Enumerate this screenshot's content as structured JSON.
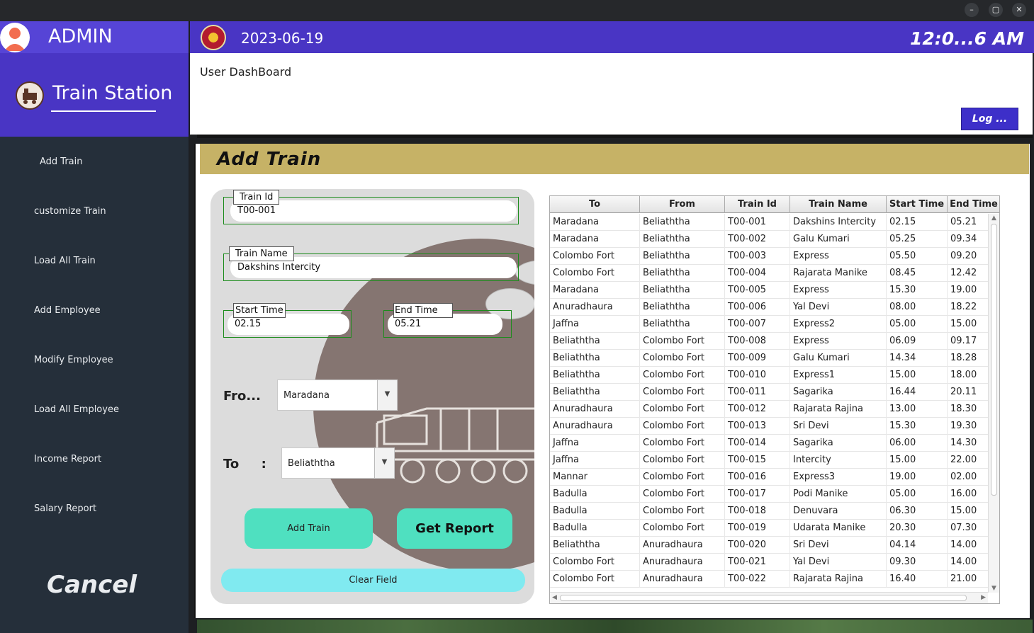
{
  "window": {
    "minimize": "–",
    "maximize": "▢",
    "close": "✕"
  },
  "sidebar": {
    "user_label": "ADMIN",
    "brand": "Train Station",
    "items": [
      {
        "label": "Add Train"
      },
      {
        "label": "customize Train"
      },
      {
        "label": "Load All Train"
      },
      {
        "label": "Add Employee"
      },
      {
        "label": "Modify Employee"
      },
      {
        "label": "Load All Employee"
      },
      {
        "label": "Income Report"
      },
      {
        "label": "Salary Report"
      }
    ],
    "cancel": "Cancel"
  },
  "header": {
    "date": "2023-06-19",
    "clock": "12:0...6 AM"
  },
  "dashboard": {
    "label": "User DashBoard",
    "log_button": "Log ..."
  },
  "panel": {
    "title": "Add  Train"
  },
  "form": {
    "train_id_label": "Train Id",
    "train_id_value": "T00-001",
    "train_name_label": "Train Name",
    "train_name_value": "Dakshins Intercity",
    "start_time_label": "Start  Time",
    "start_time_value": "02.15",
    "end_time_label": "End Time",
    "end_time_value": "05.21",
    "from_label": "Fro...",
    "from_value": "Maradana",
    "to_label": "To     :",
    "to_value": "Beliaththa",
    "add_button": "Add Train",
    "report_button": "Get Report",
    "clear_button": "Clear Field"
  },
  "table": {
    "columns": [
      "To",
      "From",
      "Train Id",
      "Train Name",
      "Start Time",
      "End Time"
    ],
    "rows": [
      [
        "Maradana",
        "Beliaththa",
        "T00-001",
        "Dakshins Intercity",
        "02.15",
        "05.21"
      ],
      [
        "Maradana",
        "Beliaththa",
        "T00-002",
        "Galu Kumari",
        "05.25",
        "09.34"
      ],
      [
        "Colombo Fort",
        "Beliaththa",
        "T00-003",
        "Express",
        "05.50",
        "09.20"
      ],
      [
        "Colombo Fort",
        "Beliaththa",
        "T00-004",
        "Rajarata Manike",
        "08.45",
        "12.42"
      ],
      [
        "Maradana",
        "Beliaththa",
        "T00-005",
        "Express",
        "15.30",
        "19.00"
      ],
      [
        "Anuradhaura",
        "Beliaththa",
        "T00-006",
        "Yal Devi",
        "08.00",
        "18.22"
      ],
      [
        "Jaffna",
        "Beliaththa",
        "T00-007",
        "Express2",
        "05.00",
        "15.00"
      ],
      [
        "Beliaththa",
        "Colombo Fort",
        "T00-008",
        "Express",
        "06.09",
        "09.17"
      ],
      [
        "Beliaththa",
        "Colombo Fort",
        "T00-009",
        "Galu Kumari",
        "14.34",
        "18.28"
      ],
      [
        "Beliaththa",
        "Colombo Fort",
        "T00-010",
        "Express1",
        "15.00",
        "18.00"
      ],
      [
        "Beliaththa",
        "Colombo Fort",
        "T00-011",
        "Sagarika",
        "16.44",
        "20.11"
      ],
      [
        "Anuradhaura",
        "Colombo Fort",
        "T00-012",
        "Rajarata Rajina",
        "13.00",
        "18.30"
      ],
      [
        "Anuradhaura",
        "Colombo Fort",
        "T00-013",
        "Sri Devi",
        "15.30",
        "19.30"
      ],
      [
        "Jaffna",
        "Colombo Fort",
        "T00-014",
        "Sagarika",
        "06.00",
        "14.30"
      ],
      [
        "Jaffna",
        "Colombo Fort",
        "T00-015",
        "Intercity",
        "15.00",
        "22.00"
      ],
      [
        "Mannar",
        "Colombo Fort",
        "T00-016",
        "Express3",
        "19.00",
        "02.00"
      ],
      [
        "Badulla",
        "Colombo Fort",
        "T00-017",
        "Podi Manike",
        "05.00",
        "16.00"
      ],
      [
        "Badulla",
        "Colombo Fort",
        "T00-018",
        "Denuvara",
        "06.30",
        "15.00"
      ],
      [
        "Badulla",
        "Colombo Fort",
        "T00-019",
        "Udarata Manike",
        "20.30",
        "07.30"
      ],
      [
        "Beliaththa",
        "Anuradhaura",
        "T00-020",
        "Sri Devi",
        "04.14",
        "14.00"
      ],
      [
        "Colombo Fort",
        "Anuradhaura",
        "T00-021",
        "Yal Devi",
        "09.30",
        "14.00"
      ],
      [
        "Colombo Fort",
        "Anuradhaura",
        "T00-022",
        "Rajarata Rajina",
        "16.40",
        "21.00"
      ]
    ]
  },
  "colors": {
    "accent": "#4935c4",
    "sidebar": "#252f3a",
    "banner": "#c6b266",
    "button": "#4fe0c0",
    "clear": "#80eaf0"
  }
}
